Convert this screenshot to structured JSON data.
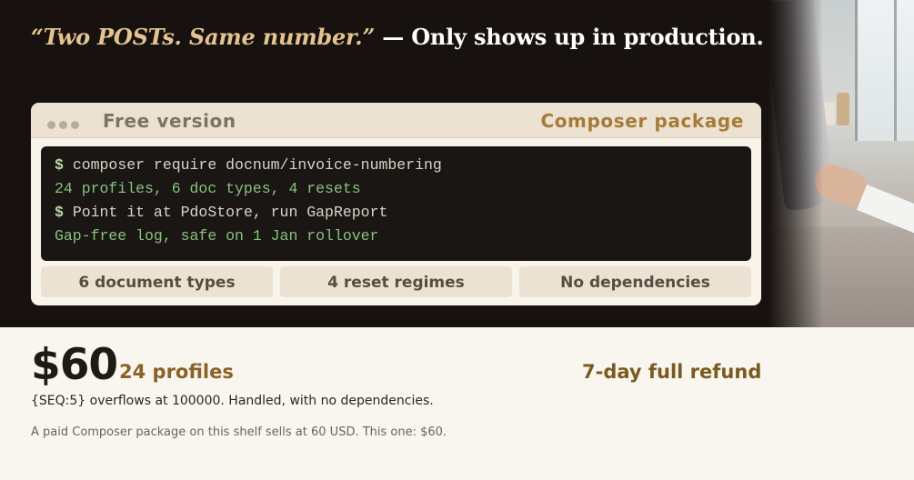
{
  "headline": {
    "quote": "“Two POSTs. Same number.”",
    "rest": " — Only shows up in production."
  },
  "card": {
    "tab_free": "Free version",
    "tab_composer": "Composer package",
    "terminal": {
      "lines": [
        {
          "prompt": "$",
          "text": "composer require docnum/invoice-numbering"
        },
        {
          "text": "24 profiles, 6 doc types, 4 resets"
        },
        {
          "prompt": "$",
          "text": "Point it at PdoStore, run GapReport"
        },
        {
          "text": "Gap-free log, safe on 1 Jan rollover"
        }
      ]
    },
    "pills": [
      "6 document types",
      "4 reset regimes",
      "No dependencies"
    ]
  },
  "pricing": {
    "price": "$60",
    "profiles": "24 profiles",
    "refund": "7-day full refund",
    "note": "{SEQ:5} overflows at 100000. Handled, with no dependencies.",
    "comparison": "A paid Composer package on this shelf sells at 60 USD. This one: $60."
  },
  "colors": {
    "hero_bg": "#171210",
    "quote_gold": "#e3c48f",
    "accent_brown": "#a57b37",
    "terminal_bg": "#1a1613",
    "terminal_green": "#86c17c",
    "page_bg": "#f9f6ef"
  }
}
